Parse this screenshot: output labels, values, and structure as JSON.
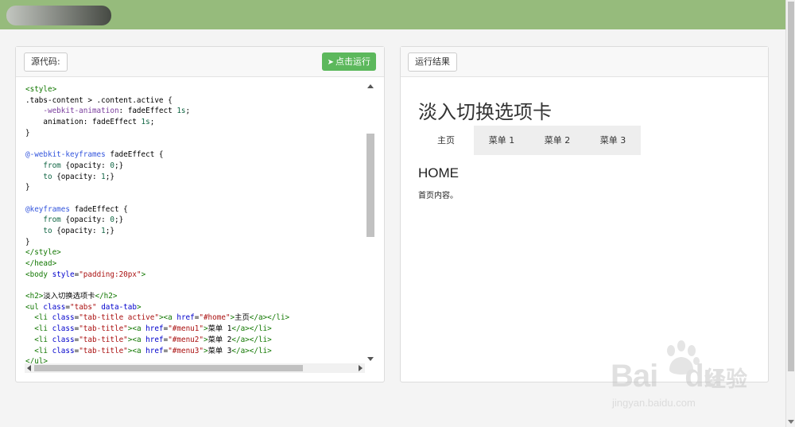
{
  "source_panel": {
    "label": "源代码:",
    "run_button": "点击运行",
    "code_lines": [
      [
        [
          "tag",
          "<style>"
        ]
      ],
      [
        [
          "text",
          ".tabs-content > .content.active {"
        ]
      ],
      [
        [
          "text",
          "    "
        ],
        [
          "kw",
          "-webkit-animation"
        ],
        [
          "text",
          ": fadeEffect "
        ],
        [
          "num",
          "1s"
        ],
        [
          "text",
          ";"
        ]
      ],
      [
        [
          "text",
          "    "
        ],
        [
          "text",
          "animation: fadeEffect "
        ],
        [
          "num",
          "1s"
        ],
        [
          "text",
          ";"
        ]
      ],
      [
        [
          "text",
          "}"
        ]
      ],
      [
        [
          "text",
          ""
        ]
      ],
      [
        [
          "at",
          "@-webkit-keyframes"
        ],
        [
          "text",
          " fadeEffect {"
        ]
      ],
      [
        [
          "text",
          "    "
        ],
        [
          "num",
          "from"
        ],
        [
          "text",
          " {opacity: "
        ],
        [
          "num",
          "0"
        ],
        [
          "text",
          ";}"
        ]
      ],
      [
        [
          "text",
          "    "
        ],
        [
          "num",
          "to"
        ],
        [
          "text",
          " {opacity: "
        ],
        [
          "num",
          "1"
        ],
        [
          "text",
          ";}"
        ]
      ],
      [
        [
          "text",
          "}"
        ]
      ],
      [
        [
          "text",
          ""
        ]
      ],
      [
        [
          "at",
          "@keyframes"
        ],
        [
          "text",
          " fadeEffect {"
        ]
      ],
      [
        [
          "text",
          "    "
        ],
        [
          "num",
          "from"
        ],
        [
          "text",
          " {opacity: "
        ],
        [
          "num",
          "0"
        ],
        [
          "text",
          ";}"
        ]
      ],
      [
        [
          "text",
          "    "
        ],
        [
          "num",
          "to"
        ],
        [
          "text",
          " {opacity: "
        ],
        [
          "num",
          "1"
        ],
        [
          "text",
          ";}"
        ]
      ],
      [
        [
          "text",
          "}"
        ]
      ],
      [
        [
          "tag",
          "</style>"
        ]
      ],
      [
        [
          "tag",
          "</head>"
        ]
      ],
      [
        [
          "tag",
          "<body"
        ],
        [
          "attr",
          " style"
        ],
        [
          "text",
          "="
        ],
        [
          "val",
          "\"padding:20px\""
        ],
        [
          "tag",
          ">"
        ]
      ],
      [
        [
          "text",
          ""
        ]
      ],
      [
        [
          "tag",
          "<h2>"
        ],
        [
          "text",
          "淡入切换选项卡"
        ],
        [
          "tag",
          "</h2>"
        ]
      ],
      [
        [
          "tag",
          "<ul"
        ],
        [
          "attr",
          " class"
        ],
        [
          "text",
          "="
        ],
        [
          "val",
          "\"tabs\""
        ],
        [
          "attr",
          " data-tab"
        ],
        [
          "tag",
          ">"
        ]
      ],
      [
        [
          "text",
          "  "
        ],
        [
          "tag",
          "<li"
        ],
        [
          "attr",
          " class"
        ],
        [
          "text",
          "="
        ],
        [
          "val",
          "\"tab-title active\""
        ],
        [
          "tag",
          "><a"
        ],
        [
          "attr",
          " href"
        ],
        [
          "text",
          "="
        ],
        [
          "val",
          "\"#home\""
        ],
        [
          "tag",
          ">"
        ],
        [
          "text",
          "主页"
        ],
        [
          "tag",
          "</a></li>"
        ]
      ],
      [
        [
          "text",
          "  "
        ],
        [
          "tag",
          "<li"
        ],
        [
          "attr",
          " class"
        ],
        [
          "text",
          "="
        ],
        [
          "val",
          "\"tab-title\""
        ],
        [
          "tag",
          "><a"
        ],
        [
          "attr",
          " href"
        ],
        [
          "text",
          "="
        ],
        [
          "val",
          "\"#menu1\""
        ],
        [
          "tag",
          ">"
        ],
        [
          "text",
          "菜单 1"
        ],
        [
          "tag",
          "</a></li>"
        ]
      ],
      [
        [
          "text",
          "  "
        ],
        [
          "tag",
          "<li"
        ],
        [
          "attr",
          " class"
        ],
        [
          "text",
          "="
        ],
        [
          "val",
          "\"tab-title\""
        ],
        [
          "tag",
          "><a"
        ],
        [
          "attr",
          " href"
        ],
        [
          "text",
          "="
        ],
        [
          "val",
          "\"#menu2\""
        ],
        [
          "tag",
          ">"
        ],
        [
          "text",
          "菜单 2"
        ],
        [
          "tag",
          "</a></li>"
        ]
      ],
      [
        [
          "text",
          "  "
        ],
        [
          "tag",
          "<li"
        ],
        [
          "attr",
          " class"
        ],
        [
          "text",
          "="
        ],
        [
          "val",
          "\"tab-title\""
        ],
        [
          "tag",
          "><a"
        ],
        [
          "attr",
          " href"
        ],
        [
          "text",
          "="
        ],
        [
          "val",
          "\"#menu3\""
        ],
        [
          "tag",
          ">"
        ],
        [
          "text",
          "菜单 3"
        ],
        [
          "tag",
          "</a></li>"
        ]
      ],
      [
        [
          "tag",
          "</ul>"
        ]
      ]
    ]
  },
  "result_panel": {
    "label": "运行结果",
    "title": "淡入切换选项卡",
    "tabs": [
      "主页",
      "菜单 1",
      "菜单 2",
      "菜单 3"
    ],
    "active_tab": 0,
    "content_heading": "HOME",
    "content_text": "首页内容。"
  },
  "watermark": {
    "word": "Bai",
    "word2": "du",
    "cn": "经验",
    "url": "jingyan.baidu.com"
  },
  "colors": {
    "topbar": "#96bb7c",
    "run_button": "#5cb85c"
  }
}
